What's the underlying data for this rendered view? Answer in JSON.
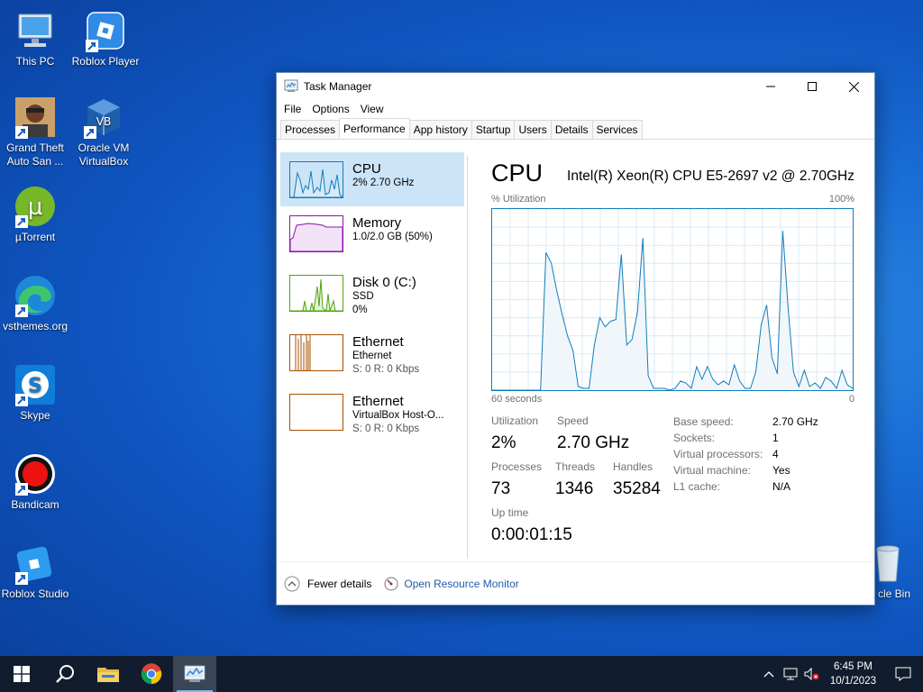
{
  "desktop": {
    "icons": [
      {
        "label": "This PC",
        "icon": "this-pc-icon"
      },
      {
        "label": "Roblox Player",
        "icon": "roblox-player-icon"
      },
      {
        "label": "Grand Theft Auto San ...",
        "icon": "gta-icon"
      },
      {
        "label": "Oracle VM VirtualBox",
        "icon": "virtualbox-icon"
      },
      {
        "label": "µTorrent",
        "icon": "utorrent-icon"
      },
      {
        "label": "vsthemes.org",
        "icon": "edge-icon"
      },
      {
        "label": "Skype",
        "icon": "skype-icon"
      },
      {
        "label": "Bandicam",
        "icon": "bandicam-icon"
      },
      {
        "label": "Roblox Studio",
        "icon": "roblox-studio-icon"
      },
      {
        "label": "cle Bin",
        "icon": "recycle-bin-icon"
      }
    ]
  },
  "window": {
    "title": "Task Manager",
    "menu": [
      "File",
      "Options",
      "View"
    ],
    "tabs": [
      "Processes",
      "Performance",
      "App history",
      "Startup",
      "Users",
      "Details",
      "Services"
    ],
    "active_tab": "Performance"
  },
  "sidebar": {
    "items": [
      {
        "name": "CPU",
        "sub1": "2% 2.70 GHz",
        "sub2": "",
        "color": "#117dbb"
      },
      {
        "name": "Memory",
        "sub1": "1.0/2.0 GB (50%)",
        "sub2": "",
        "color": "#8b12ae"
      },
      {
        "name": "Disk 0 (C:)",
        "sub1": "SSD",
        "sub2": "0%",
        "color": "#4da60c"
      },
      {
        "name": "Ethernet",
        "sub1": "Ethernet",
        "sub2": "S: 0 R: 0 Kbps",
        "color": "#a74f01"
      },
      {
        "name": "Ethernet",
        "sub1": "VirtualBox Host-O...",
        "sub2": "S: 0 R: 0 Kbps",
        "color": "#a74f01"
      }
    ]
  },
  "cpu_panel": {
    "title": "CPU",
    "model": "Intel(R) Xeon(R) CPU E5-2697 v2 @ 2.70GHz",
    "util_label": "% Utilization",
    "max_label": "100%",
    "time_label": "60 seconds",
    "min_label": "0",
    "stats": {
      "utilization_label": "Utilization",
      "utilization": "2%",
      "speed_label": "Speed",
      "speed": "2.70 GHz",
      "processes_label": "Processes",
      "processes": "73",
      "threads_label": "Threads",
      "threads": "1346",
      "handles_label": "Handles",
      "handles": "35284",
      "uptime_label": "Up time",
      "uptime": "0:00:01:15"
    },
    "details": {
      "base_speed_k": "Base speed:",
      "base_speed_v": "2.70 GHz",
      "sockets_k": "Sockets:",
      "sockets_v": "1",
      "vproc_k": "Virtual processors:",
      "vproc_v": "4",
      "vm_k": "Virtual machine:",
      "vm_v": "Yes",
      "l1_k": "L1 cache:",
      "l1_v": "N/A"
    },
    "history": [
      0,
      0,
      0,
      0,
      0,
      0,
      0,
      0,
      0,
      0,
      76,
      70,
      55,
      42,
      30,
      22,
      2,
      1,
      1,
      25,
      40,
      35,
      38,
      39,
      75,
      25,
      28,
      43,
      84,
      8,
      1,
      1,
      1,
      0,
      1,
      5,
      4,
      1,
      13,
      6,
      13,
      6,
      3,
      5,
      3,
      14,
      5,
      1,
      1,
      10,
      36,
      47,
      18,
      9,
      88,
      45,
      10,
      2,
      11,
      2,
      4,
      1,
      7,
      5,
      1,
      11,
      3,
      1
    ]
  },
  "footer": {
    "fewer_details": "Fewer details",
    "open_resource_monitor": "Open Resource Monitor"
  },
  "taskbar": {
    "apps": [
      "start-icon",
      "search-icon",
      "file-explorer-icon",
      "chrome-icon",
      "task-manager-icon"
    ],
    "time": "6:45 PM",
    "date": "10/1/2023"
  },
  "colors": {
    "cpu": "#117dbb",
    "desktop": "#1465cc",
    "taskbar": "#111d2e"
  }
}
